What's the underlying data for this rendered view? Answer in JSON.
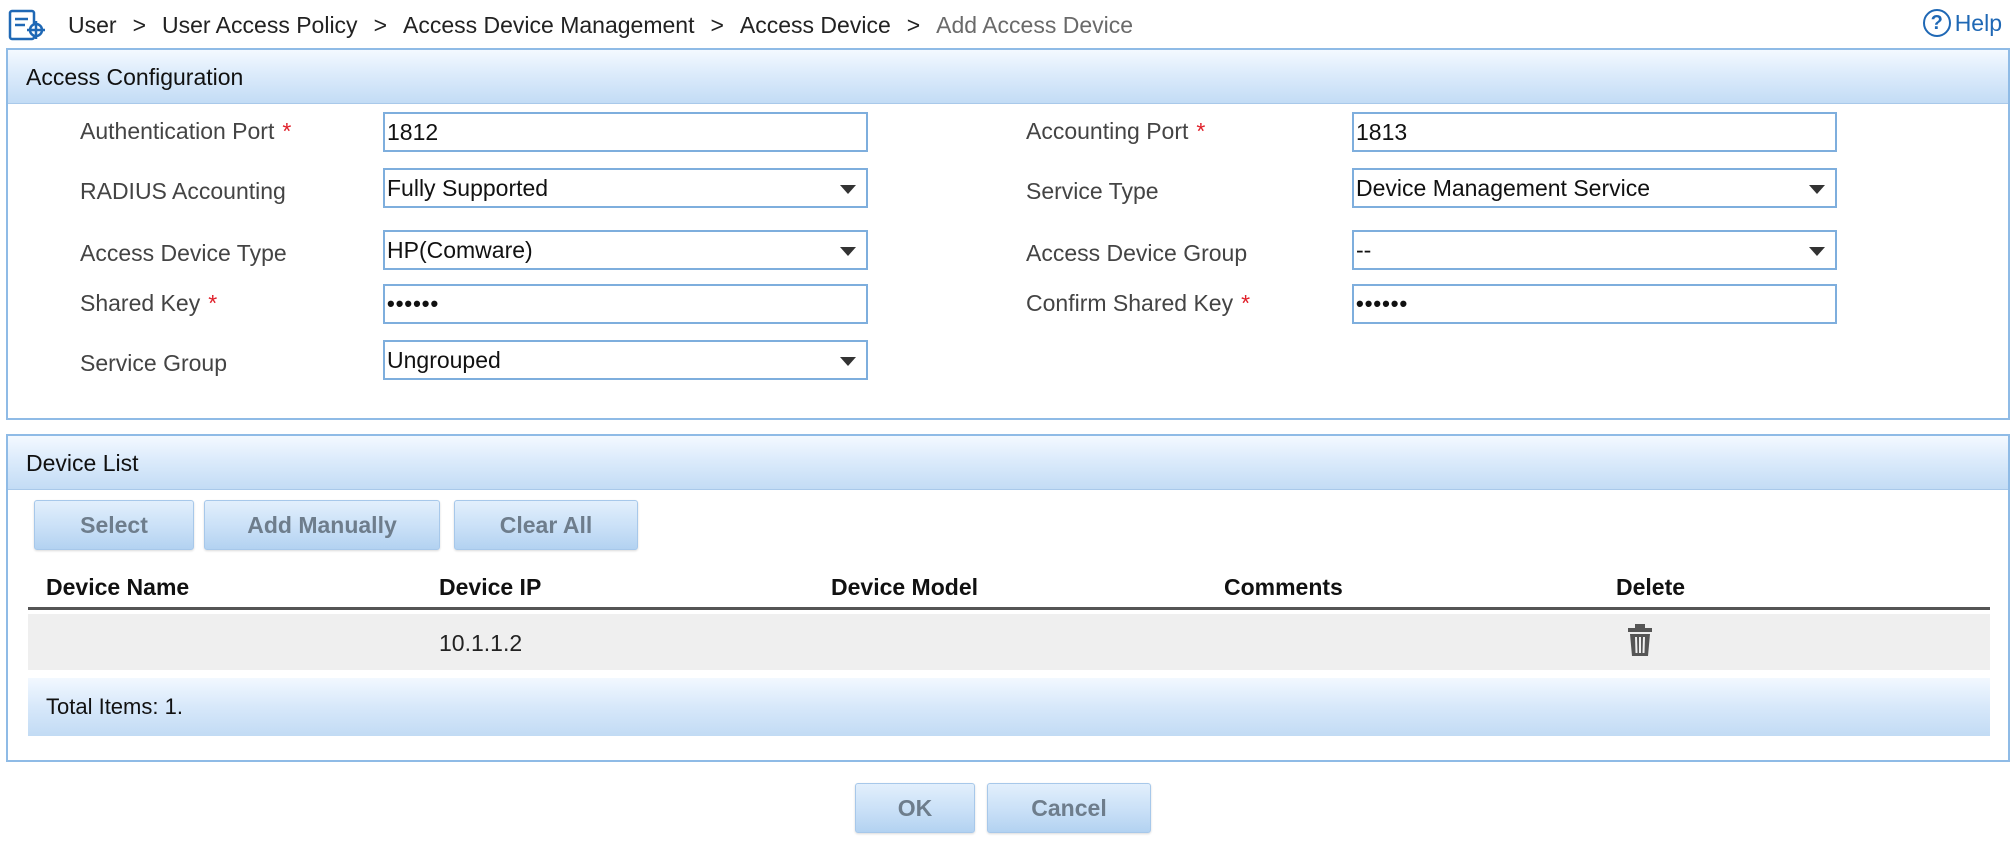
{
  "breadcrumb": {
    "items": [
      "User",
      "User Access Policy",
      "Access Device Management",
      "Access Device"
    ],
    "current": "Add Access Device",
    "separator": ">"
  },
  "help": {
    "label": "Help",
    "icon": "help-circle-icon"
  },
  "access_config": {
    "title": "Access Configuration",
    "authentication_port": {
      "label": "Authentication Port",
      "required": "*",
      "value": "1812"
    },
    "accounting_port": {
      "label": "Accounting Port",
      "required": "*",
      "value": "1813"
    },
    "radius_accounting": {
      "label": "RADIUS Accounting",
      "value": "Fully Supported"
    },
    "service_type": {
      "label": "Service Type",
      "value": "Device Management Service"
    },
    "access_device_type": {
      "label": "Access Device Type",
      "value": "HP(Comware)"
    },
    "access_device_group": {
      "label": "Access Device Group",
      "value": "--"
    },
    "shared_key": {
      "label": "Shared Key",
      "required": "*",
      "value": "••••••"
    },
    "confirm_shared_key": {
      "label": "Confirm Shared Key",
      "required": "*",
      "value": "••••••"
    },
    "service_group": {
      "label": "Service Group",
      "value": "Ungrouped"
    }
  },
  "device_list": {
    "title": "Device List",
    "buttons": {
      "select": "Select",
      "add_manually": "Add Manually",
      "clear_all": "Clear All"
    },
    "columns": [
      "Device Name",
      "Device IP",
      "Device Model",
      "Comments",
      "Delete"
    ],
    "rows": [
      {
        "device_name": "",
        "device_ip": "10.1.1.2",
        "device_model": "",
        "comments": "",
        "delete_icon": "trash-icon"
      }
    ],
    "total": "Total Items: 1."
  },
  "actions": {
    "ok": "OK",
    "cancel": "Cancel"
  },
  "colors": {
    "accent": "#1f68b5",
    "panel_border": "#8fbbe6",
    "required": "#e0202a"
  }
}
